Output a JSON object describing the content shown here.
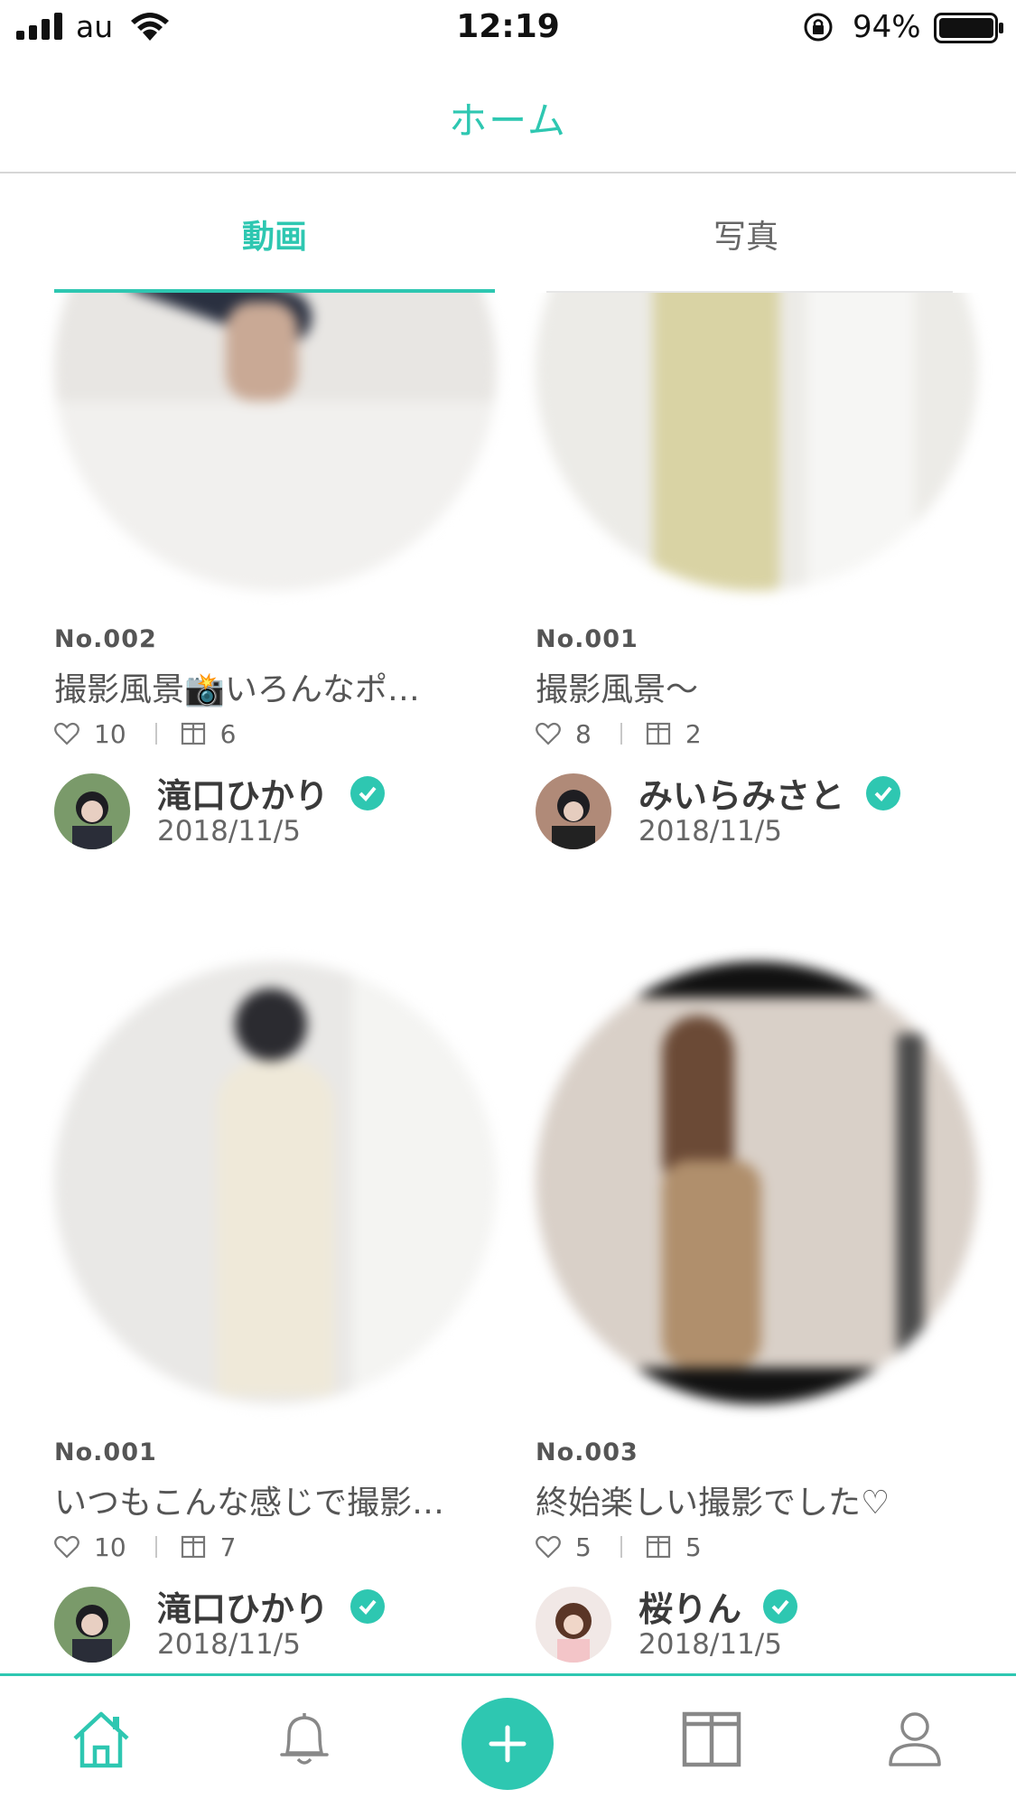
{
  "status_bar": {
    "carrier": "au",
    "time": "12:19",
    "battery_percent": "94%",
    "battery_level": 0.94
  },
  "header": {
    "title": "ホーム"
  },
  "tabs": [
    {
      "label": "動画",
      "active": true
    },
    {
      "label": "写真",
      "active": false
    }
  ],
  "accent_color": "#2ec7b1",
  "posts": [
    {
      "number": "No.002",
      "title": "撮影風景📸いろんなポ…",
      "likes": "10",
      "items": "6",
      "author": "滝口ひかり",
      "verified": true,
      "date": "2018/11/5"
    },
    {
      "number": "No.001",
      "title": "撮影風景〜",
      "likes": "8",
      "items": "2",
      "author": "みいらみさと",
      "verified": true,
      "date": "2018/11/5"
    },
    {
      "number": "No.001",
      "title": "いつもこんな感じで撮影…",
      "likes": "10",
      "items": "7",
      "author": "滝口ひかり",
      "verified": true,
      "date": "2018/11/5"
    },
    {
      "number": "No.003",
      "title": "終始楽しい撮影でした♡",
      "likes": "5",
      "items": "5",
      "author": "桜りん",
      "verified": true,
      "date": "2018/11/5"
    }
  ],
  "bottom_nav": [
    {
      "icon": "home-icon",
      "active": true
    },
    {
      "icon": "bell-icon",
      "active": false
    },
    {
      "icon": "plus-icon",
      "active": false
    },
    {
      "icon": "book-icon",
      "active": false
    },
    {
      "icon": "user-icon",
      "active": false
    }
  ]
}
